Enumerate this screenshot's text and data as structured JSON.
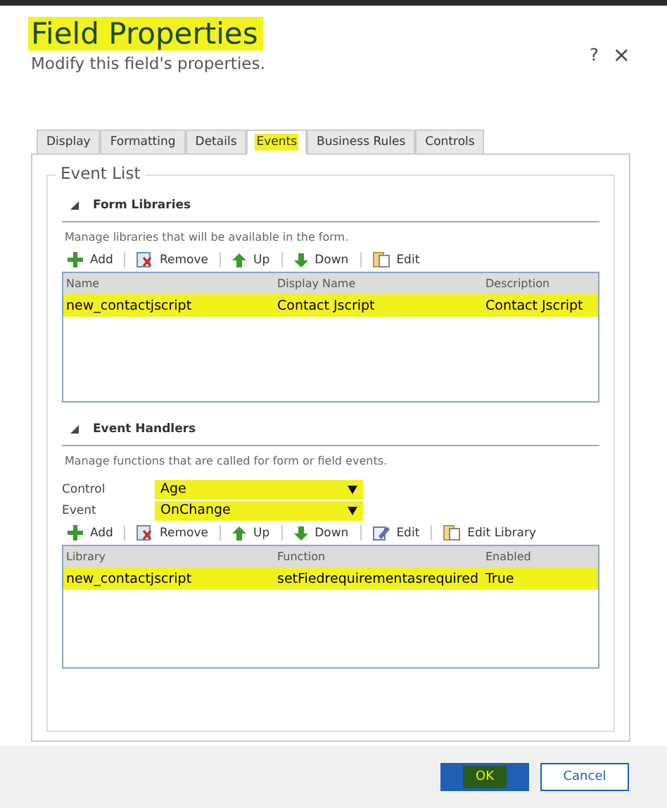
{
  "dialog": {
    "title": "Field Properties",
    "title_highlighted": true,
    "subtitle": "Modify this field's properties.",
    "help": "?",
    "close": "×"
  },
  "tabs": [
    {
      "label": "Display",
      "selected": false,
      "highlighted": false
    },
    {
      "label": "Formatting",
      "selected": false,
      "highlighted": false
    },
    {
      "label": "Details",
      "selected": false,
      "highlighted": false
    },
    {
      "label": "Events",
      "selected": true,
      "highlighted": true
    },
    {
      "label": "Business Rules",
      "selected": false,
      "highlighted": false
    },
    {
      "label": "Controls",
      "selected": false,
      "highlighted": false
    }
  ],
  "event_list": {
    "legend": "Event List",
    "sections": [
      {
        "title": "Form Libraries",
        "expanded": true,
        "description": "Manage libraries that will be available in the form.",
        "toolbar": [
          {
            "kind": "add",
            "label": "Add"
          },
          {
            "kind": "remove",
            "label": "Remove"
          },
          {
            "kind": "up",
            "label": "Up"
          },
          {
            "kind": "down",
            "label": "Down"
          },
          {
            "kind": "edit",
            "label": "Edit"
          }
        ],
        "columns": [
          "Name",
          "Display Name",
          "Description"
        ],
        "rows": [
          {
            "cells": [
              "new_contactjscript",
              "Contact Jscript",
              "Contact Jscript"
            ],
            "highlighted": true
          }
        ]
      },
      {
        "title": "Event Handlers",
        "expanded": true,
        "description": "Manage functions that are called for form or field events.",
        "selects": [
          {
            "label": "Control",
            "value": "Age",
            "highlighted": true
          },
          {
            "label": "Event",
            "value": "OnChange",
            "highlighted": true
          }
        ],
        "toolbar": [
          {
            "kind": "add",
            "label": "Add"
          },
          {
            "kind": "remove",
            "label": "Remove"
          },
          {
            "kind": "up",
            "label": "Up"
          },
          {
            "kind": "down",
            "label": "Down"
          },
          {
            "kind": "edit-pen",
            "label": "Edit"
          },
          {
            "kind": "edit",
            "label": "Edit Library"
          }
        ],
        "columns": [
          "Library",
          "Function",
          "Enabled"
        ],
        "rows": [
          {
            "cells": [
              "new_contactjscript",
              "setFiedrequirementasrequired",
              "True"
            ],
            "highlighted": true
          }
        ]
      }
    ]
  },
  "buttons": [
    {
      "label": "OK",
      "kind": "primary",
      "highlighted": true
    },
    {
      "label": "Cancel",
      "kind": "secondary"
    }
  ]
}
